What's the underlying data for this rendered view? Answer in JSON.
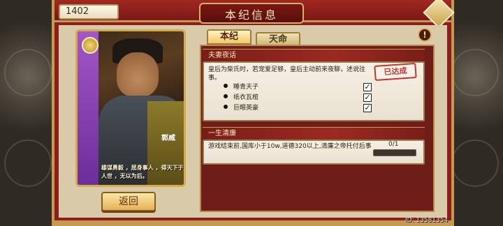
{
  "header": {
    "title": "本纪信息",
    "counter": "1402"
  },
  "portrait": {
    "name": "郭威",
    "quote": "雄谋勇毅 ，屈身事人 ，得天下于人世 ，无以为后。"
  },
  "buttons": {
    "back_label": "返回"
  },
  "tabs": [
    {
      "label": "本纪",
      "active": true
    },
    {
      "label": "天命",
      "active": false
    }
  ],
  "sections": {
    "couple": {
      "title": "夫妻夜话",
      "description": "皇后为柴氏时，若宠爱足够，皇后主动前来夜聊，述说往事。",
      "stamp": "已达成",
      "conditions": [
        {
          "label": "睡青天子",
          "checked": true
        },
        {
          "label": "纸衣瓦棺",
          "checked": true
        },
        {
          "label": "巨眼英豪",
          "checked": true
        }
      ]
    },
    "honest": {
      "title": "一生清廉",
      "description": "游戏结束前,国库小于10w,道德320以上,清廉之帝托付后事",
      "progress": "0/1",
      "progress_fraction": 0
    }
  },
  "footer": {
    "id": "ID: 13581354"
  },
  "colors": {
    "frame_red": "#8c1f1b",
    "gold_trim": "#c49a52",
    "stamp_red": "#c2362e"
  },
  "icons": {
    "warning": "exclamation-icon",
    "check": "checkmark-icon"
  }
}
